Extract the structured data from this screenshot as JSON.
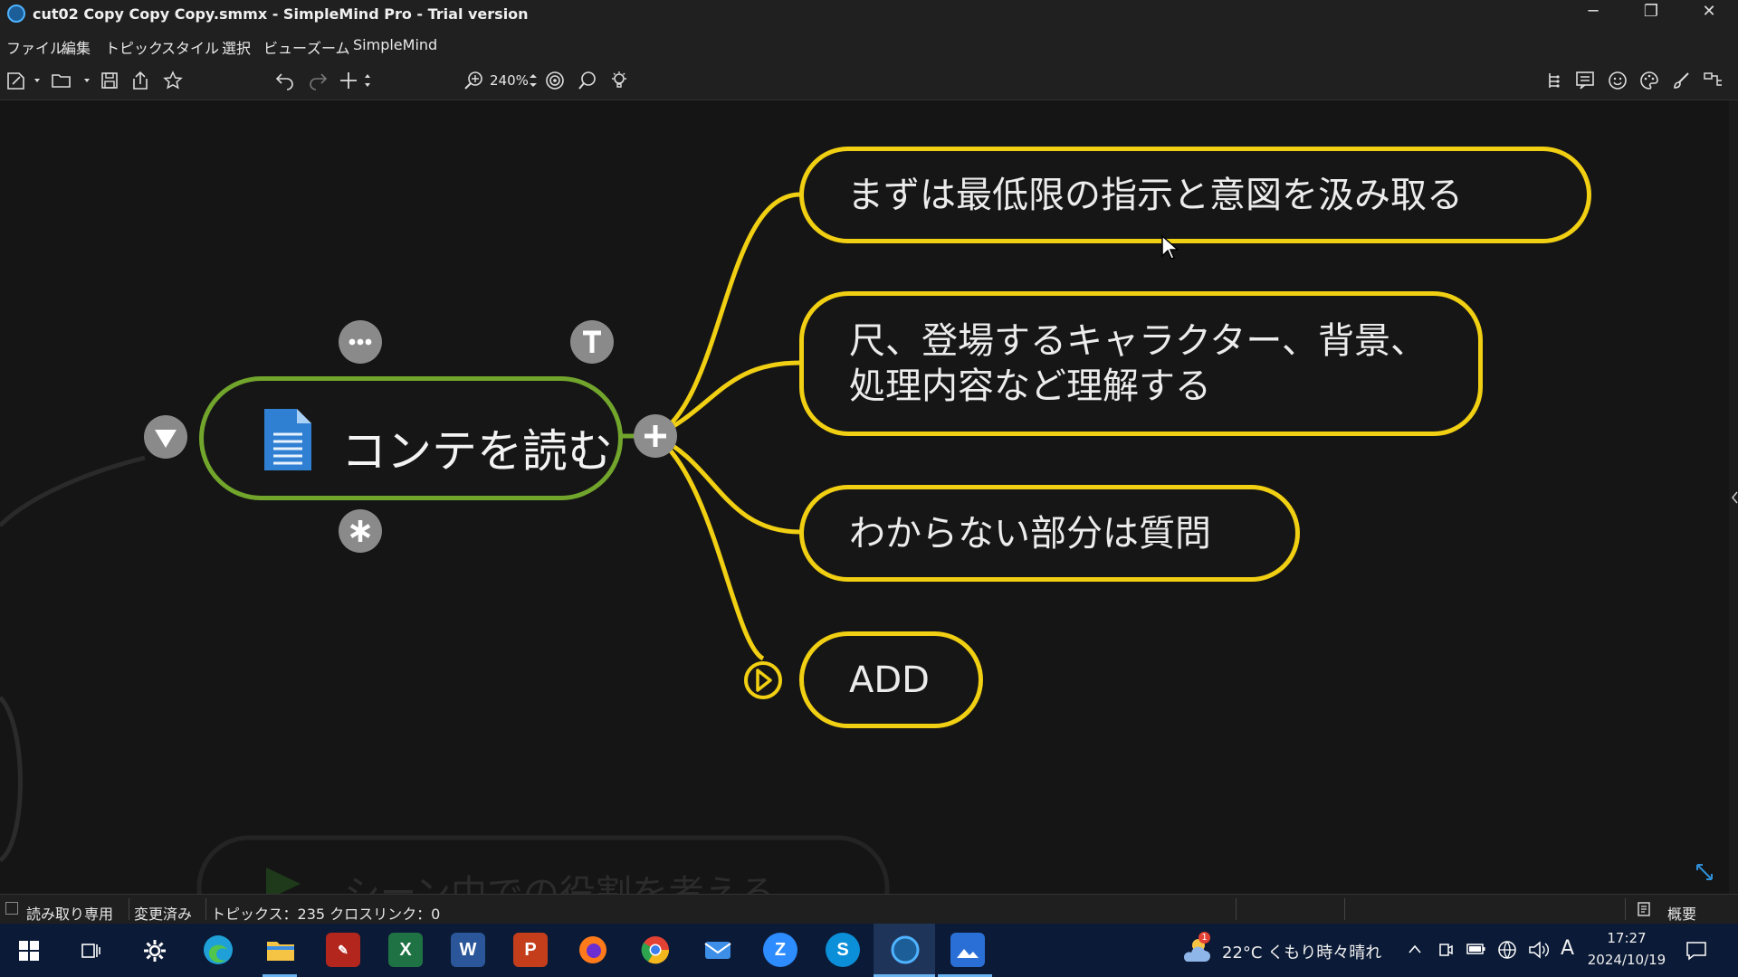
{
  "window": {
    "title": "cut02 Copy Copy Copy.smmx - SimpleMind Pro - Trial version",
    "controls": {
      "minimize": "─",
      "restore": "❐",
      "close": "✕"
    }
  },
  "menu": [
    "ファイル",
    "編集",
    "トピック",
    "スタイル",
    "選択",
    "ビュー",
    "ズーム",
    "SimpleMind"
  ],
  "toolbar": {
    "zoom": "240%"
  },
  "mindmap": {
    "central": {
      "label": "コンテを読む",
      "color": "#72a52c"
    },
    "branch_color": "#f1cf12",
    "topics": [
      {
        "lines": [
          "まずは最低限の指示と意図を汲み取る"
        ]
      },
      {
        "lines": [
          "尺、登場するキャラクター、背景、",
          "処理内容など理解する"
        ]
      },
      {
        "lines": [
          "わからない部分は質問"
        ]
      },
      {
        "lines": [
          "ADD"
        ]
      }
    ],
    "background_text": "シーン中での役割を考える"
  },
  "statusbar": {
    "readonly": "読み取り専用",
    "modified": "変更済み",
    "counts": "トピックス：235 クロスリンク：0",
    "outline": "概要"
  },
  "taskbar": {
    "weather": "22°C  くもり時々晴れ",
    "weather_badge": "1",
    "ime": "A",
    "time": "17:27",
    "date": "2024/10/19"
  }
}
